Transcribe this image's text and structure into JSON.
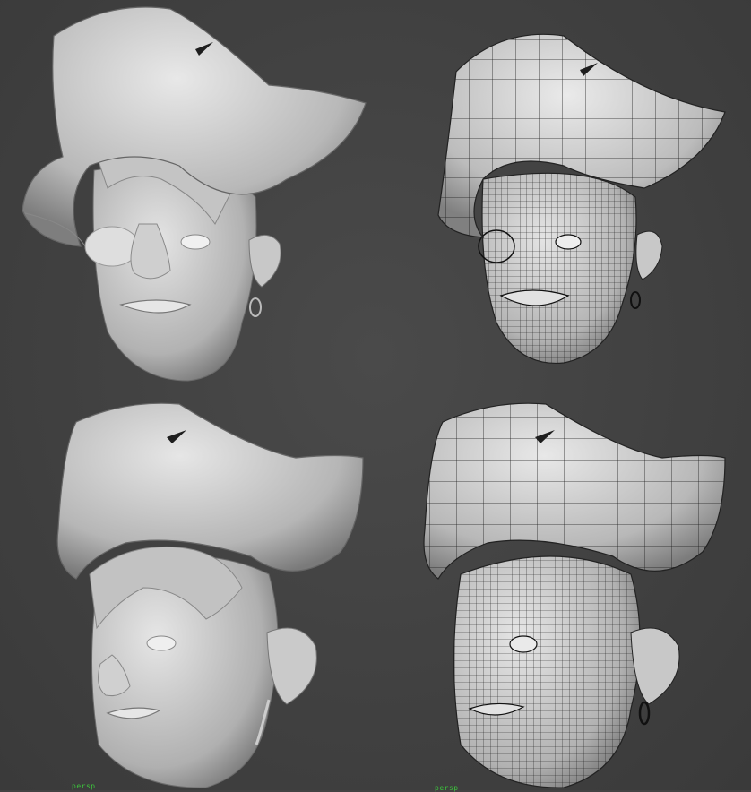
{
  "viewports": [
    {
      "id": "top-left",
      "mode": "smooth-shaded"
    },
    {
      "id": "top-right",
      "mode": "wireframe-on-shaded"
    },
    {
      "id": "bottom-left",
      "mode": "smooth-shaded",
      "camera_label": "persp"
    },
    {
      "id": "bottom-right",
      "mode": "wireframe-on-shaded",
      "camera_label": "persp"
    }
  ],
  "colors": {
    "background": "#424242",
    "model_light": "#e2e2e2",
    "model_dark": "#8a8a8a",
    "wire": "#1c1c1c",
    "label": "#3cc23c"
  },
  "subject": "pirate-head-3d-model"
}
